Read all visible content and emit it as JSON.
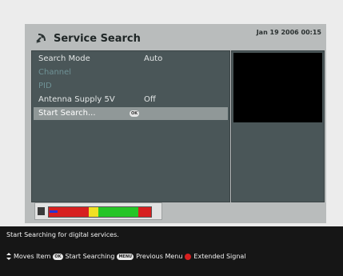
{
  "header": {
    "title": "Service Search",
    "icon": "satellite-dish-icon",
    "datetime": "Jan 19 2006 00:15"
  },
  "menu": {
    "items": [
      {
        "label": "Search Mode",
        "value": "Auto",
        "state": "active"
      },
      {
        "label": "Channel",
        "value": "",
        "state": "disabled"
      },
      {
        "label": "PID",
        "value": "",
        "state": "disabled"
      },
      {
        "label": "Antenna Supply 5V",
        "value": "Off",
        "state": "active"
      },
      {
        "label": "Start Search...",
        "badge": "OK",
        "state": "selected"
      }
    ]
  },
  "signal": {
    "level": 0.08,
    "colors": {
      "low": "#d71f1f",
      "mid": "#f1e022",
      "good": "#26c526",
      "marker": "#2634d4"
    }
  },
  "help": {
    "description": "Start Searching for digital services.",
    "legend": [
      {
        "icon": "up-down-arrows-icon",
        "text": "Moves Item"
      },
      {
        "badge": "OK",
        "text": "Start Searching"
      },
      {
        "badge": "MENU",
        "text": "Previous Menu"
      },
      {
        "icon": "red-button-icon",
        "text": "Extended Signal"
      }
    ]
  }
}
